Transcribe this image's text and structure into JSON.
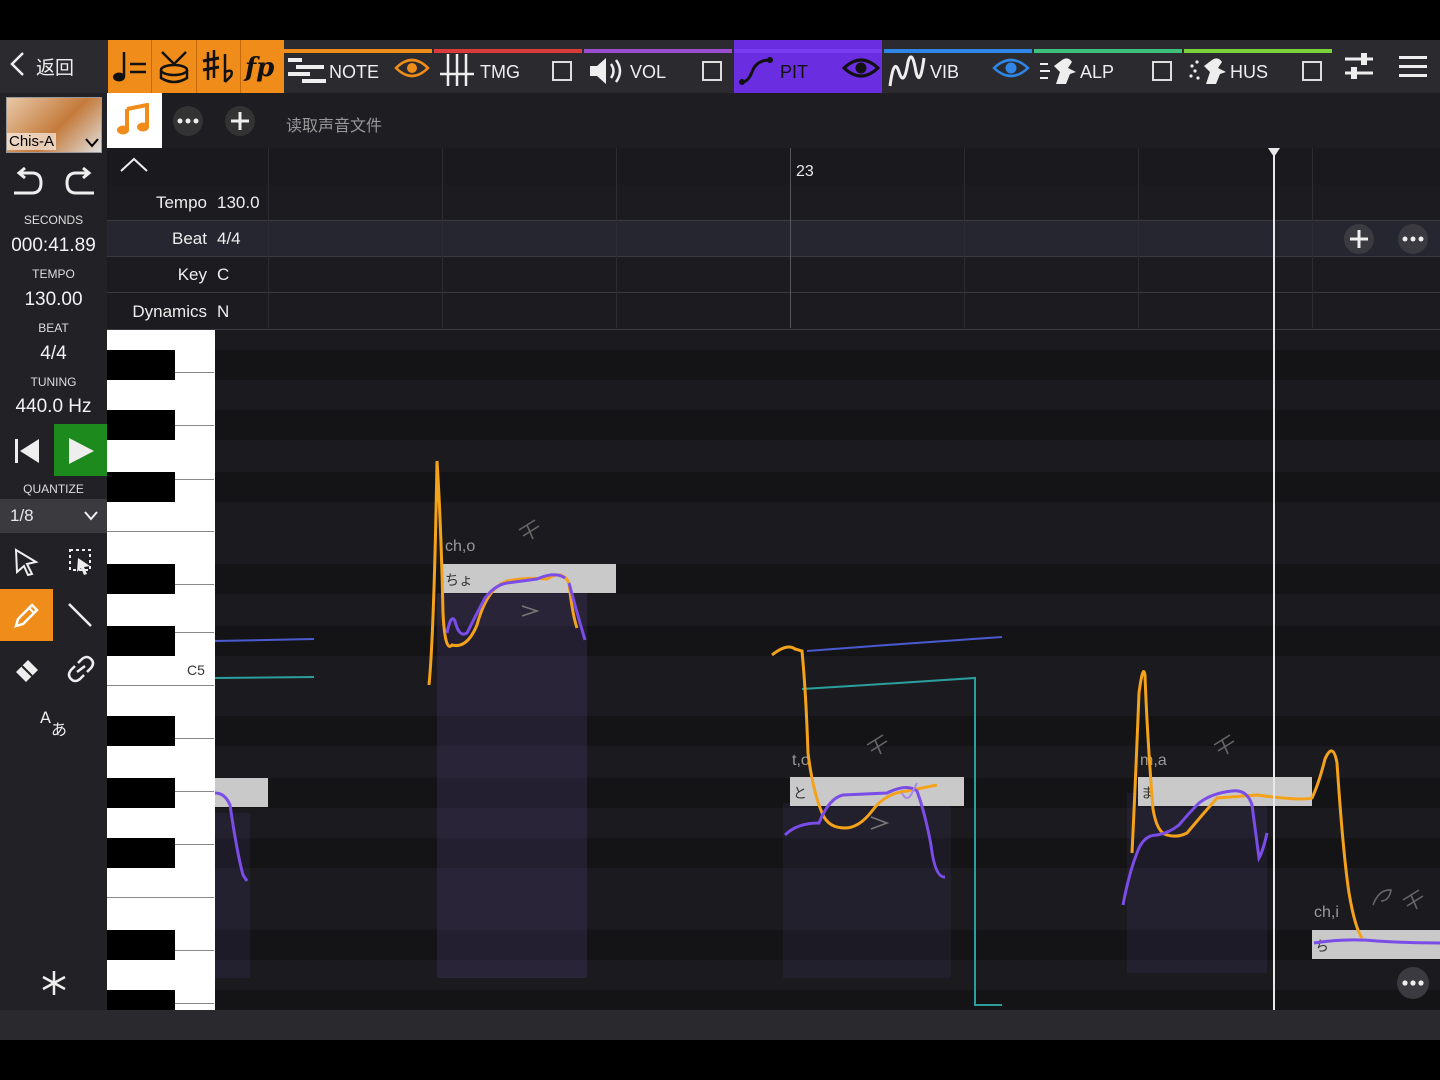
{
  "toolbar": {
    "back_label": "返回",
    "tabs": [
      {
        "label": "NOTE",
        "color": "#f08c1a"
      },
      {
        "label": "TMG",
        "color": "#d93a3a"
      },
      {
        "label": "VOL",
        "color": "#9b4fd0"
      },
      {
        "label": "PIT",
        "color": "#7a3cf0"
      },
      {
        "label": "VIB",
        "color": "#2f86e6"
      },
      {
        "label": "ALP",
        "color": "#3cc07a"
      },
      {
        "label": "HUS",
        "color": "#7bd23a"
      }
    ]
  },
  "voice": {
    "name": "Chis-A"
  },
  "track": {
    "load_audio_label": "读取声音文件"
  },
  "ruler": {
    "measure": "23"
  },
  "header": {
    "tempo_label": "Tempo",
    "tempo_value": "130.0",
    "beat_label": "Beat",
    "beat_value": "4/4",
    "key_label": "Key",
    "key_value": "C",
    "dynamics_label": "Dynamics",
    "dynamics_value": "N"
  },
  "status": {
    "seconds_label": "SECONDS",
    "seconds_value": "000:41.89",
    "tempo_label": "TEMPO",
    "tempo_value": "130.00",
    "beat_label": "BEAT",
    "beat_value": "4/4",
    "tuning_label": "TUNING",
    "tuning_value": "440.0 Hz",
    "quantize_label": "QUANTIZE",
    "quantize_value": "1/8"
  },
  "piano": {
    "c5_label": "C5"
  },
  "notes": [
    {
      "lyric": "ちょ",
      "phoneme": "ch,o"
    },
    {
      "lyric": "と",
      "phoneme": "t,o"
    },
    {
      "lyric": "ま",
      "phoneme": "m,a"
    },
    {
      "lyric": "ち",
      "phoneme": "ch,i"
    }
  ],
  "colors": {
    "accent": "#f08c1a",
    "play": "#1d8a1d",
    "pitch_orange": "#f5a21b",
    "pitch_purple": "#7a4de8",
    "teal": "#2b9e9e"
  }
}
